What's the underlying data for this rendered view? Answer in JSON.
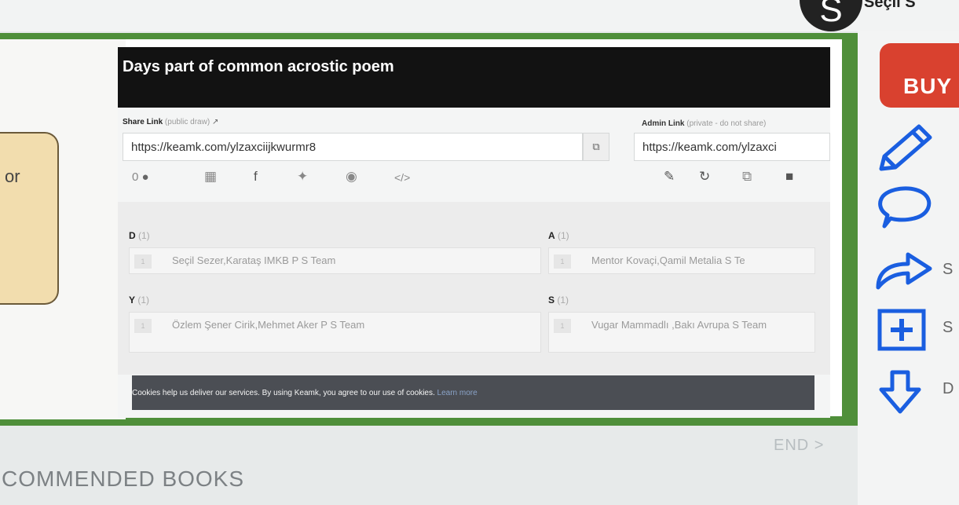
{
  "header": {
    "avatar_letter": "S",
    "username": "Seçil S"
  },
  "background": {
    "scroll_text": "or",
    "end_link": "END >",
    "recommended": "COMMENDED BOOKS"
  },
  "right_panel": {
    "buy_label": "BUY",
    "icons": [
      {
        "icon": "pencil-icon",
        "label": ""
      },
      {
        "icon": "comment-icon",
        "label": ""
      },
      {
        "icon": "share-arrow-icon",
        "label": "S"
      },
      {
        "icon": "plus-box-icon",
        "label": "S"
      },
      {
        "icon": "download-arrow-icon",
        "label": "D"
      }
    ]
  },
  "modal": {
    "title": "Days part of common acrostic poem",
    "subtitle": "",
    "share": {
      "label": "Share Link",
      "hint": "(public draw)",
      "url": "https://keamk.com/ylzaxciijkwurmr8"
    },
    "admin": {
      "label": "Admin Link",
      "hint": "(private - do not share)",
      "url": "https://keamk.com/ylzaxci"
    },
    "comment_count": "0",
    "letters": [
      {
        "letter": "D",
        "count": "(1)",
        "num": "1",
        "entry": "Seçil Sezer,Karataş IMKB P S Team"
      },
      {
        "letter": "A",
        "count": "(1)",
        "num": "1",
        "entry": "Mentor Kovaçi,Qamil Metalia S Te"
      },
      {
        "letter": "Y",
        "count": "(1)",
        "num": "1",
        "entry": "Özlem Şener Cirik,Mehmet Aker P S Team"
      },
      {
        "letter": "S",
        "count": "(1)",
        "num": "1",
        "entry": "Vugar Mammadlı ,Bakı Avrupa S Team"
      }
    ],
    "cookie": {
      "text": "Cookies help us deliver our services. By using Keamk, you agree to our use of cookies.",
      "link": "Learn more"
    }
  },
  "colors": {
    "accent_blue": "#1a5ee0",
    "buy_red": "#d9412f",
    "header_black": "#121212",
    "frame_green": "#4f8f3a"
  }
}
